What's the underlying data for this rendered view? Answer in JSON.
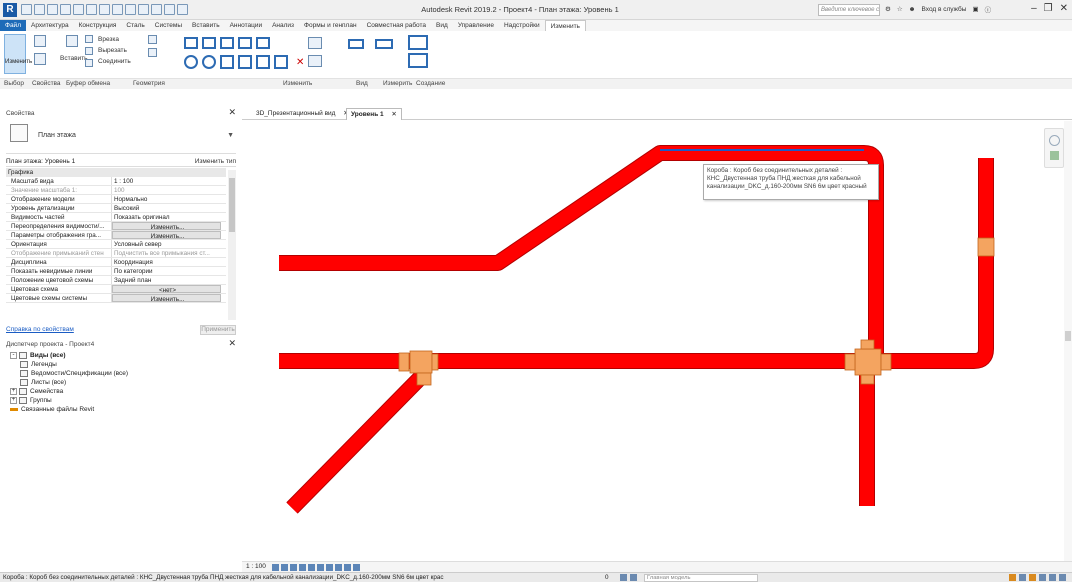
{
  "titlebar": {
    "app_logo": "R",
    "title": "Autodesk Revit 2019.2 - Проект4 - План этажа: Уровень 1",
    "search_placeholder": "Введите ключевое слово/фразу",
    "signin": "Вход в службы",
    "icons": [
      "binoculars-icon",
      "star-icon",
      "user-icon",
      "cart-icon",
      "help-icon"
    ]
  },
  "tabs": [
    {
      "label": "Файл",
      "type": "file"
    },
    {
      "label": "Архитектура"
    },
    {
      "label": "Конструкция"
    },
    {
      "label": "Сталь"
    },
    {
      "label": "Системы"
    },
    {
      "label": "Вставить"
    },
    {
      "label": "Аннотации"
    },
    {
      "label": "Анализ"
    },
    {
      "label": "Формы и генплан"
    },
    {
      "label": "Совместная работа"
    },
    {
      "label": "Вид"
    },
    {
      "label": "Управление"
    },
    {
      "label": "Надстройки"
    },
    {
      "label": "Изменить",
      "type": "active"
    }
  ],
  "ribbon": {
    "modify_label": "Изменить",
    "paste_label": "Вставить",
    "cope_label": "Врезка",
    "cut_label": "Вырезать",
    "join_label": "Соединить",
    "panels": {
      "select": "Выбор",
      "properties": "Свойства",
      "clipboard": "Буфер обмена",
      "geometry": "Геометрия",
      "modify": "Изменить",
      "view": "Вид",
      "measure": "Измерить",
      "create": "Создание"
    }
  },
  "properties": {
    "title": "Свойства",
    "type_name": "План этажа",
    "instance": "План этажа: Уровень 1",
    "edit_type": "Изменить тип",
    "category": "Графика",
    "rows": [
      {
        "key": "Масштаб вида",
        "value": "1 : 100"
      },
      {
        "key": "Значение масштаба    1:",
        "value": "100",
        "dim": true
      },
      {
        "key": "Отображение модели",
        "value": "Нормально"
      },
      {
        "key": "Уровень детализации",
        "value": "Высокий"
      },
      {
        "key": "Видимость частей",
        "value": "Показать оригинал"
      },
      {
        "key": "Переопределения видимости/...",
        "value": "Изменить...",
        "button": true
      },
      {
        "key": "Параметры отображения гра...",
        "value": "Изменить...",
        "button": true
      },
      {
        "key": "Ориентация",
        "value": "Условный север"
      },
      {
        "key": "Отображение примыканий стен",
        "value": "Подчистить все примыкания ст...",
        "dim": true
      },
      {
        "key": "Дисциплина",
        "value": "Координация"
      },
      {
        "key": "Показать невидимые линии",
        "value": "По категории"
      },
      {
        "key": "Положение цветовой схемы",
        "value": "Задний план"
      },
      {
        "key": "Цветовая схема",
        "value": "<нет>",
        "button": true
      },
      {
        "key": "Цветовые схемы системы",
        "value": "Изменить...",
        "button": true
      }
    ],
    "help": "Справка по свойствам",
    "apply": "Применить"
  },
  "browser": {
    "title": "Диспетчер проекта - Проект4",
    "items": [
      {
        "label": "Виды (все)",
        "toggle": "-",
        "indent": 0,
        "bold": true,
        "icon": "views-icon"
      },
      {
        "label": "Легенды",
        "toggle": "",
        "indent": 1,
        "icon": "legend-icon"
      },
      {
        "label": "Ведомости/Спецификации (все)",
        "toggle": "",
        "indent": 1,
        "icon": "schedule-icon"
      },
      {
        "label": "Листы (все)",
        "toggle": "",
        "indent": 1,
        "icon": "sheet-icon"
      },
      {
        "label": "Семейства",
        "toggle": "+",
        "indent": 0,
        "icon": "family-icon"
      },
      {
        "label": "Группы",
        "toggle": "+",
        "indent": 0,
        "icon": "group-icon"
      },
      {
        "label": "Связанные файлы Revit",
        "toggle": "",
        "indent": 0,
        "icon": "link-icon"
      }
    ]
  },
  "view_tabs": [
    {
      "label": "3D_Презентационный вид"
    },
    {
      "label": "Уровень 1",
      "active": true
    }
  ],
  "tooltip": {
    "line1": "Короба : Короб без соединительных деталей :",
    "line2": "КНС_Двустенная труба ПНД жесткая для кабельной",
    "line3": "канализации_DKC_д.160-200мм SN6 6м цвет красный"
  },
  "colors": {
    "pipe": "#ff0000",
    "pipe_edge": "#b30000",
    "fitting": "#f4a460",
    "fitting_edge": "#c4651c",
    "selected": "#1e5bc6",
    "accent": "#1e6bb8"
  },
  "view_ctrl": {
    "scale": "1 : 100"
  },
  "status": {
    "text": "Короба : Короб без соединительных деталей : КНС_Двустенная труба ПНД жесткая для кабельной канализации_DKC_д.160-200мм SN6 6м цвет крас",
    "counter": "0",
    "model": "Главная модель"
  }
}
